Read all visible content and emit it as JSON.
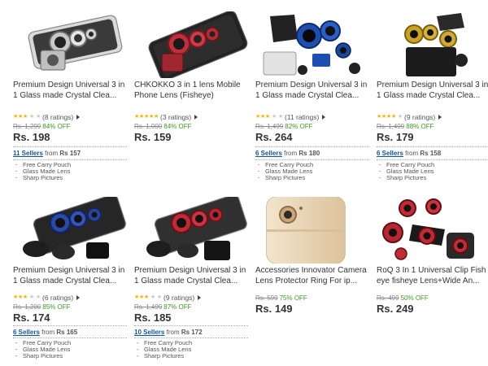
{
  "products": [
    {
      "title": "Premium Design Universal 3 in 1 Glass made Crystal Clea...",
      "stars": 3,
      "ratings": "(8 ratings)",
      "original_price": "Rs. 1,299",
      "discount": "84% OFF",
      "price": "Rs. 198",
      "sellers_link": "11 Sellers",
      "sellers_from": "from",
      "sellers_price": "Rs 157",
      "features": [
        "Free Carry Pouch",
        "Glass Made Lens",
        "Sharp Pictures"
      ],
      "image_icon": "clip-lens-kit-silver-icon"
    },
    {
      "title": "CHKOKKO 3 in 1 lens Mobile Phone Lens (Fisheye)",
      "stars": 5,
      "ratings": "(3 ratings)",
      "original_price": "Rs. 1,000",
      "discount": "84% OFF",
      "price": "Rs. 159",
      "sellers_link": "",
      "sellers_from": "",
      "sellers_price": "",
      "features": [],
      "image_icon": "clip-lens-kit-red-icon"
    },
    {
      "title": "Premium Design Universal 3 in 1 Glass made Crystal Clea...",
      "stars": 3,
      "ratings": "(11 ratings)",
      "original_price": "Rs. 1,499",
      "discount": "82% OFF",
      "price": "Rs. 264",
      "sellers_link": "6 Sellers",
      "sellers_from": "from",
      "sellers_price": "Rs 180",
      "features": [
        "Free Carry Pouch",
        "Glass Made Lens",
        "Sharp Pictures"
      ],
      "image_icon": "clip-lens-kit-blue-icon"
    },
    {
      "title": "Premium Design Universal 3 in 1 Glass made Crystal Clea...",
      "stars": 4,
      "ratings": "(9 ratings)",
      "original_price": "Rs. 1,499",
      "discount": "88% OFF",
      "price": "Rs. 179",
      "sellers_link": "6 Sellers",
      "sellers_from": "from",
      "sellers_price": "Rs 158",
      "features": [
        "Free Carry Pouch",
        "Glass Made Lens",
        "Sharp Pictures"
      ],
      "image_icon": "clip-lens-kit-gold-icon"
    },
    {
      "title": "Premium Design Universal 3 in 1 Glass made Crystal Clea...",
      "stars": 3,
      "ratings": "(6 ratings)",
      "original_price": "Rs. 1,200",
      "discount": "85% OFF",
      "price": "Rs. 174",
      "sellers_link": "6 Sellers",
      "sellers_from": "from",
      "sellers_price": "Rs 165",
      "features": [
        "Free Carry Pouch",
        "Glass Made Lens",
        "Sharp Pictures"
      ],
      "image_icon": "clip-lens-kit-blue-phone-icon"
    },
    {
      "title": "Premium Design Universal 3 in 1 Glass made Crystal Clea...",
      "stars": 3,
      "ratings": "(9 ratings)",
      "original_price": "Rs. 1,499",
      "discount": "87% OFF",
      "price": "Rs. 185",
      "sellers_link": "10 Sellers",
      "sellers_from": "from",
      "sellers_price": "Rs 172",
      "features": [
        "Free Carry Pouch",
        "Glass Made Lens",
        "Sharp Pictures"
      ],
      "image_icon": "clip-lens-kit-red-phone-icon"
    },
    {
      "title": "Accessories Innovator Camera Lens Protector Ring For ip...",
      "stars": 0,
      "ratings": "",
      "original_price": "Rs. 599",
      "discount": "75% OFF",
      "price": "Rs. 149",
      "sellers_link": "",
      "sellers_from": "",
      "sellers_price": "",
      "features": [],
      "image_icon": "gold-phone-camera-ring-icon"
    },
    {
      "title": "RoQ 3 In 1 Universal Clip Fish eye fisheye Lens+Wide An...",
      "stars": 0,
      "ratings": "",
      "original_price": "Rs. 499",
      "discount": "50% OFF",
      "price": "Rs. 249",
      "sellers_link": "",
      "sellers_from": "",
      "sellers_price": "",
      "features": [],
      "image_icon": "clip-lens-red-collage-icon"
    }
  ],
  "colors": {
    "discount": "#3c9a23",
    "sellers_link": "#1155aa",
    "star_on": "#f4b400",
    "star_off": "#c8c8c8"
  }
}
